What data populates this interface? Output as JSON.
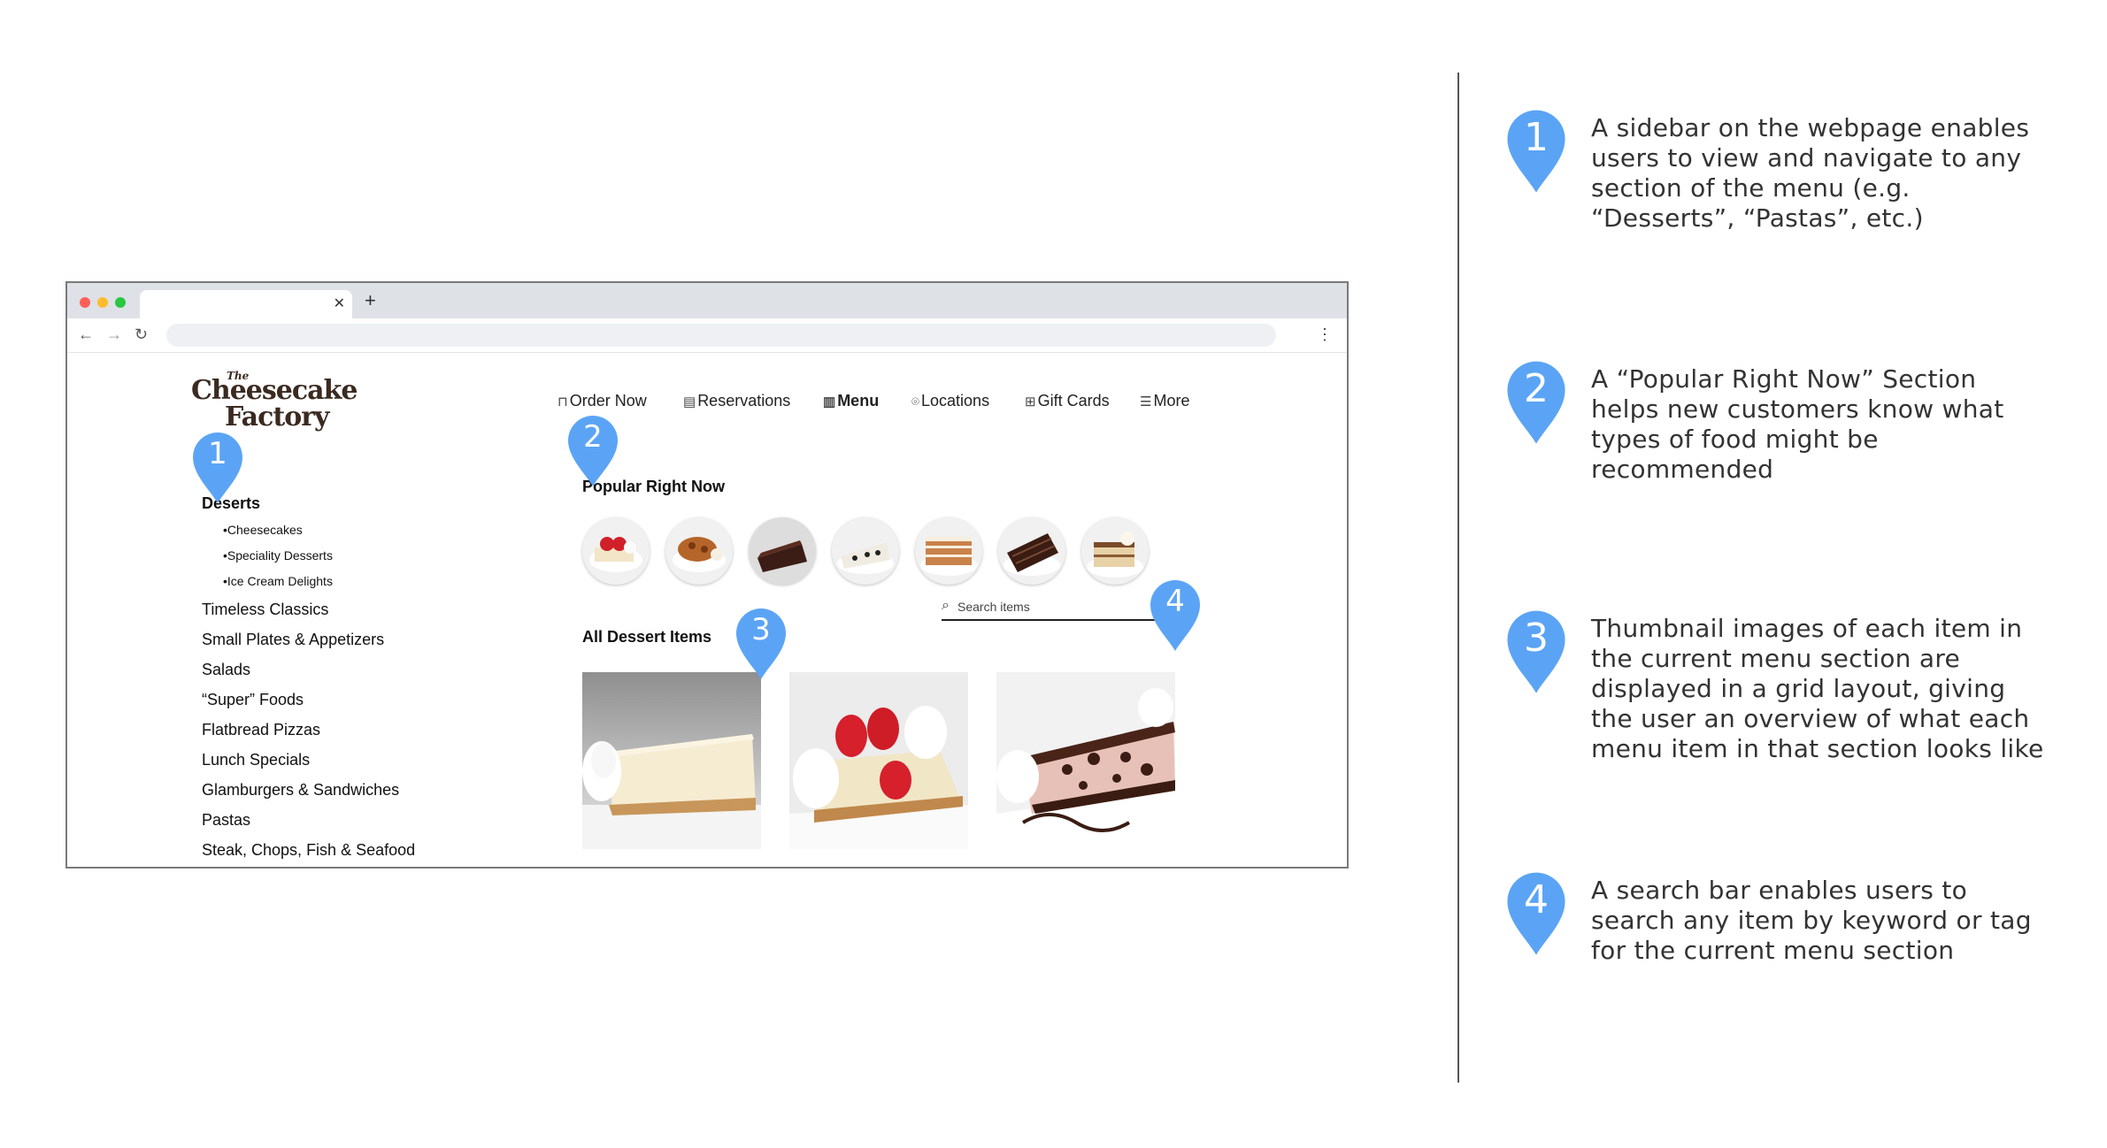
{
  "brand": {
    "logo_the": "The",
    "logo_line1": "Cheesecake",
    "logo_line2": "Factory"
  },
  "nav": {
    "order_now": "Order Now",
    "reservations": "Reservations",
    "menu": "Menu",
    "locations": "Locations",
    "gift_cards": "Gift Cards",
    "more": "More"
  },
  "sidebar": {
    "heading": "Deserts",
    "subitems": [
      "•Cheesecakes",
      "•Speciality Desserts",
      "•Ice Cream Delights"
    ],
    "items": [
      "Timeless Classics",
      "Small Plates & Appetizers",
      "Salads",
      "“Super” Foods",
      "Flatbread Pizzas",
      "Lunch Specials",
      "Glamburgers & Sandwiches",
      "Pastas",
      "Steak, Chops, Fish & Seafood"
    ]
  },
  "popular": {
    "title": "Popular Right Now"
  },
  "desserts": {
    "title": "All Dessert Items",
    "search_placeholder": "Search items"
  },
  "markers": [
    "1",
    "2",
    "3",
    "4"
  ],
  "annotations": [
    "A sidebar on the webpage enables users to view and navigate to any section of the menu (e.g. “Desserts”, “Pastas”, etc.)",
    "A “Popular Right Now” Section helps new customers know what types of food might be recommended",
    "Thumbnail images of each item in the current menu section are displayed in a grid layout, giving the user an overview of what each menu item in that section looks like",
    "A search bar enables users to search any item by keyword or tag for the current menu section"
  ],
  "colors": {
    "pin": "#5ba4f5",
    "divider": "#555555"
  }
}
